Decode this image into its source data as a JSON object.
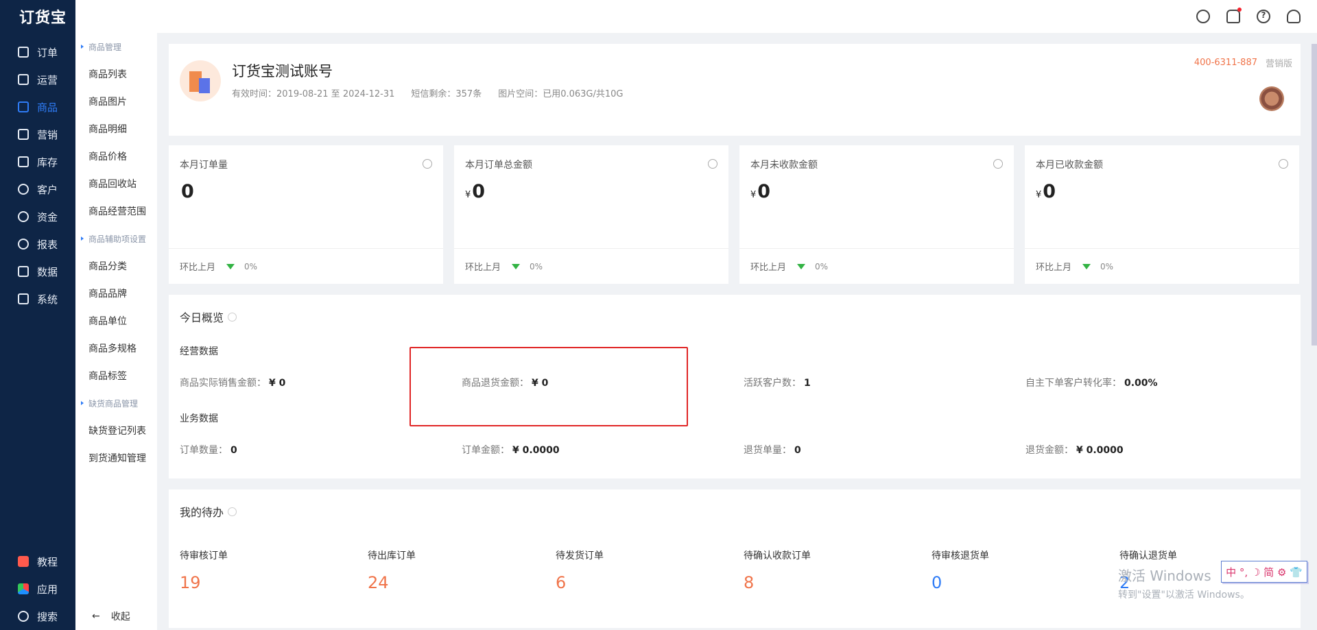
{
  "brand": {
    "logo": "订货宝"
  },
  "nav": {
    "items": [
      {
        "label": "订单",
        "icon": "order-icon"
      },
      {
        "label": "运营",
        "icon": "operation-icon"
      },
      {
        "label": "商品",
        "icon": "grid-icon",
        "active": true
      },
      {
        "label": "营销",
        "icon": "marketing-icon"
      },
      {
        "label": "库存",
        "icon": "warehouse-icon"
      },
      {
        "label": "客户",
        "icon": "user-icon"
      },
      {
        "label": "资金",
        "icon": "moneybag-icon"
      },
      {
        "label": "报表",
        "icon": "pie-chart-icon"
      },
      {
        "label": "数据",
        "icon": "data-icon"
      },
      {
        "label": "系统",
        "icon": "monitor-icon"
      }
    ],
    "bottom": [
      {
        "label": "教程",
        "icon": "play-icon"
      },
      {
        "label": "应用",
        "icon": "cube-icon"
      },
      {
        "label": "搜索",
        "icon": "search-icon"
      }
    ]
  },
  "subnav": {
    "group1": "商品管理",
    "group1_items": [
      "商品列表",
      "商品图片",
      "商品明细",
      "商品价格",
      "商品回收站",
      "商品经营范围"
    ],
    "group2": "商品辅助项设置",
    "group2_items": [
      "商品分类",
      "商品品牌",
      "商品单位",
      "商品多规格",
      "商品标签"
    ],
    "group3": "缺货商品管理",
    "group3_items": [
      "缺货登记列表",
      "到货通知管理"
    ],
    "collapse": "收起"
  },
  "account": {
    "name": "订货宝测试账号",
    "validity": "有效时间：2019-08-21 至 2024-12-31",
    "sms": "短信剩余：357条",
    "space": "图片空间：已用0.063G/共10G",
    "phone": "400-6311-887",
    "version": "营销版"
  },
  "stats": [
    {
      "label": "本月订单量",
      "value": "0",
      "currency": "",
      "compare": "环比上月",
      "pct": "0%"
    },
    {
      "label": "本月订单总金额",
      "value": "0",
      "currency": "¥",
      "compare": "环比上月",
      "pct": "0%"
    },
    {
      "label": "本月未收款金额",
      "value": "0",
      "currency": "¥",
      "compare": "环比上月",
      "pct": "0%"
    },
    {
      "label": "本月已收款金额",
      "value": "0",
      "currency": "¥",
      "compare": "环比上月",
      "pct": "0%"
    }
  ],
  "today": {
    "title": "今日概览",
    "biz_title": "经营数据",
    "biz": [
      {
        "label": "商品实际销售金额：",
        "value": "¥ 0"
      },
      {
        "label": "商品退货金额：",
        "value": "¥ 0"
      },
      {
        "label": "活跃客户数：",
        "value": "1"
      },
      {
        "label": "自主下单客户转化率：",
        "value": "0.00%"
      }
    ],
    "ops_title": "业务数据",
    "ops": [
      {
        "label": "订单数量：",
        "value": "0"
      },
      {
        "label": "订单金额：",
        "value": "¥ 0.0000"
      },
      {
        "label": "退货单量：",
        "value": "0"
      },
      {
        "label": "退货金额：",
        "value": "¥ 0.0000"
      }
    ]
  },
  "todo": {
    "title": "我的待办",
    "items": [
      {
        "label": "待审核订单",
        "value": "19"
      },
      {
        "label": "待出库订单",
        "value": "24"
      },
      {
        "label": "待发货订单",
        "value": "6"
      },
      {
        "label": "待确认收款订单",
        "value": "8"
      },
      {
        "label": "待审核退货单",
        "value": "0"
      },
      {
        "label": "待确认退货单",
        "value": "2"
      }
    ]
  },
  "watermark": {
    "line1": "激活 Windows",
    "line2": "转到\"设置\"以激活 Windows。"
  },
  "ime": {
    "text": "中 °, ☽ 简 ⚙ 👕"
  }
}
